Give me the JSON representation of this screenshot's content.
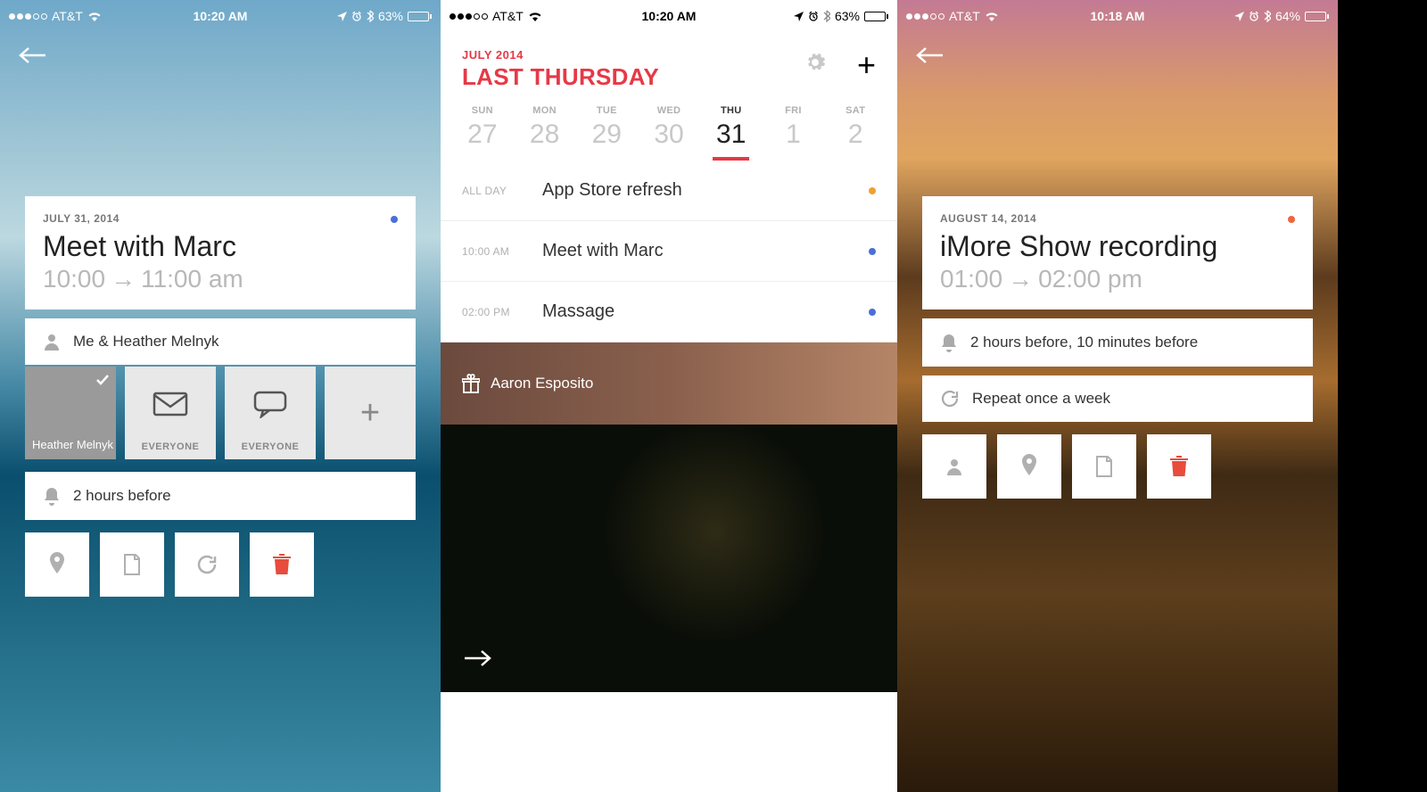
{
  "screen1": {
    "status": {
      "carrier": "AT&T",
      "time": "10:20 AM",
      "battery": "63%"
    },
    "event": {
      "date": "JULY 31, 2014",
      "title": "Meet with Marc",
      "start": "10:00",
      "end": "11:00 am"
    },
    "attendees_summary": "Me & Heather Melnyk",
    "tiles": {
      "selected_name": "Heather Melnyk",
      "email_label": "EVERYONE",
      "chat_label": "EVERYONE"
    },
    "reminder": "2 hours before"
  },
  "screen2": {
    "status": {
      "carrier": "AT&T",
      "time": "10:20 AM",
      "battery": "63%"
    },
    "header": {
      "month": "JULY 2014",
      "day_label": "LAST THURSDAY"
    },
    "week": [
      {
        "label": "SUN",
        "date": "27"
      },
      {
        "label": "MON",
        "date": "28"
      },
      {
        "label": "TUE",
        "date": "29"
      },
      {
        "label": "WED",
        "date": "30"
      },
      {
        "label": "THU",
        "date": "31",
        "today": true
      },
      {
        "label": "FRI",
        "date": "1"
      },
      {
        "label": "SAT",
        "date": "2"
      }
    ],
    "events": [
      {
        "time": "ALL DAY",
        "title": "App Store refresh",
        "dot": "dot-yellow"
      },
      {
        "time": "10:00 AM",
        "title": "Meet with Marc",
        "dot": "dot-blue"
      },
      {
        "time": "02:00 PM",
        "title": "Massage",
        "dot": "dot-blue"
      }
    ],
    "birthday": "Aaron Esposito"
  },
  "screen3": {
    "status": {
      "carrier": "AT&T",
      "time": "10:18 AM",
      "battery": "64%"
    },
    "event": {
      "date": "AUGUST 14, 2014",
      "title": "iMore Show recording",
      "start": "01:00",
      "end": "02:00 pm"
    },
    "reminder": "2 hours before, 10 minutes before",
    "repeat": "Repeat once a week"
  }
}
